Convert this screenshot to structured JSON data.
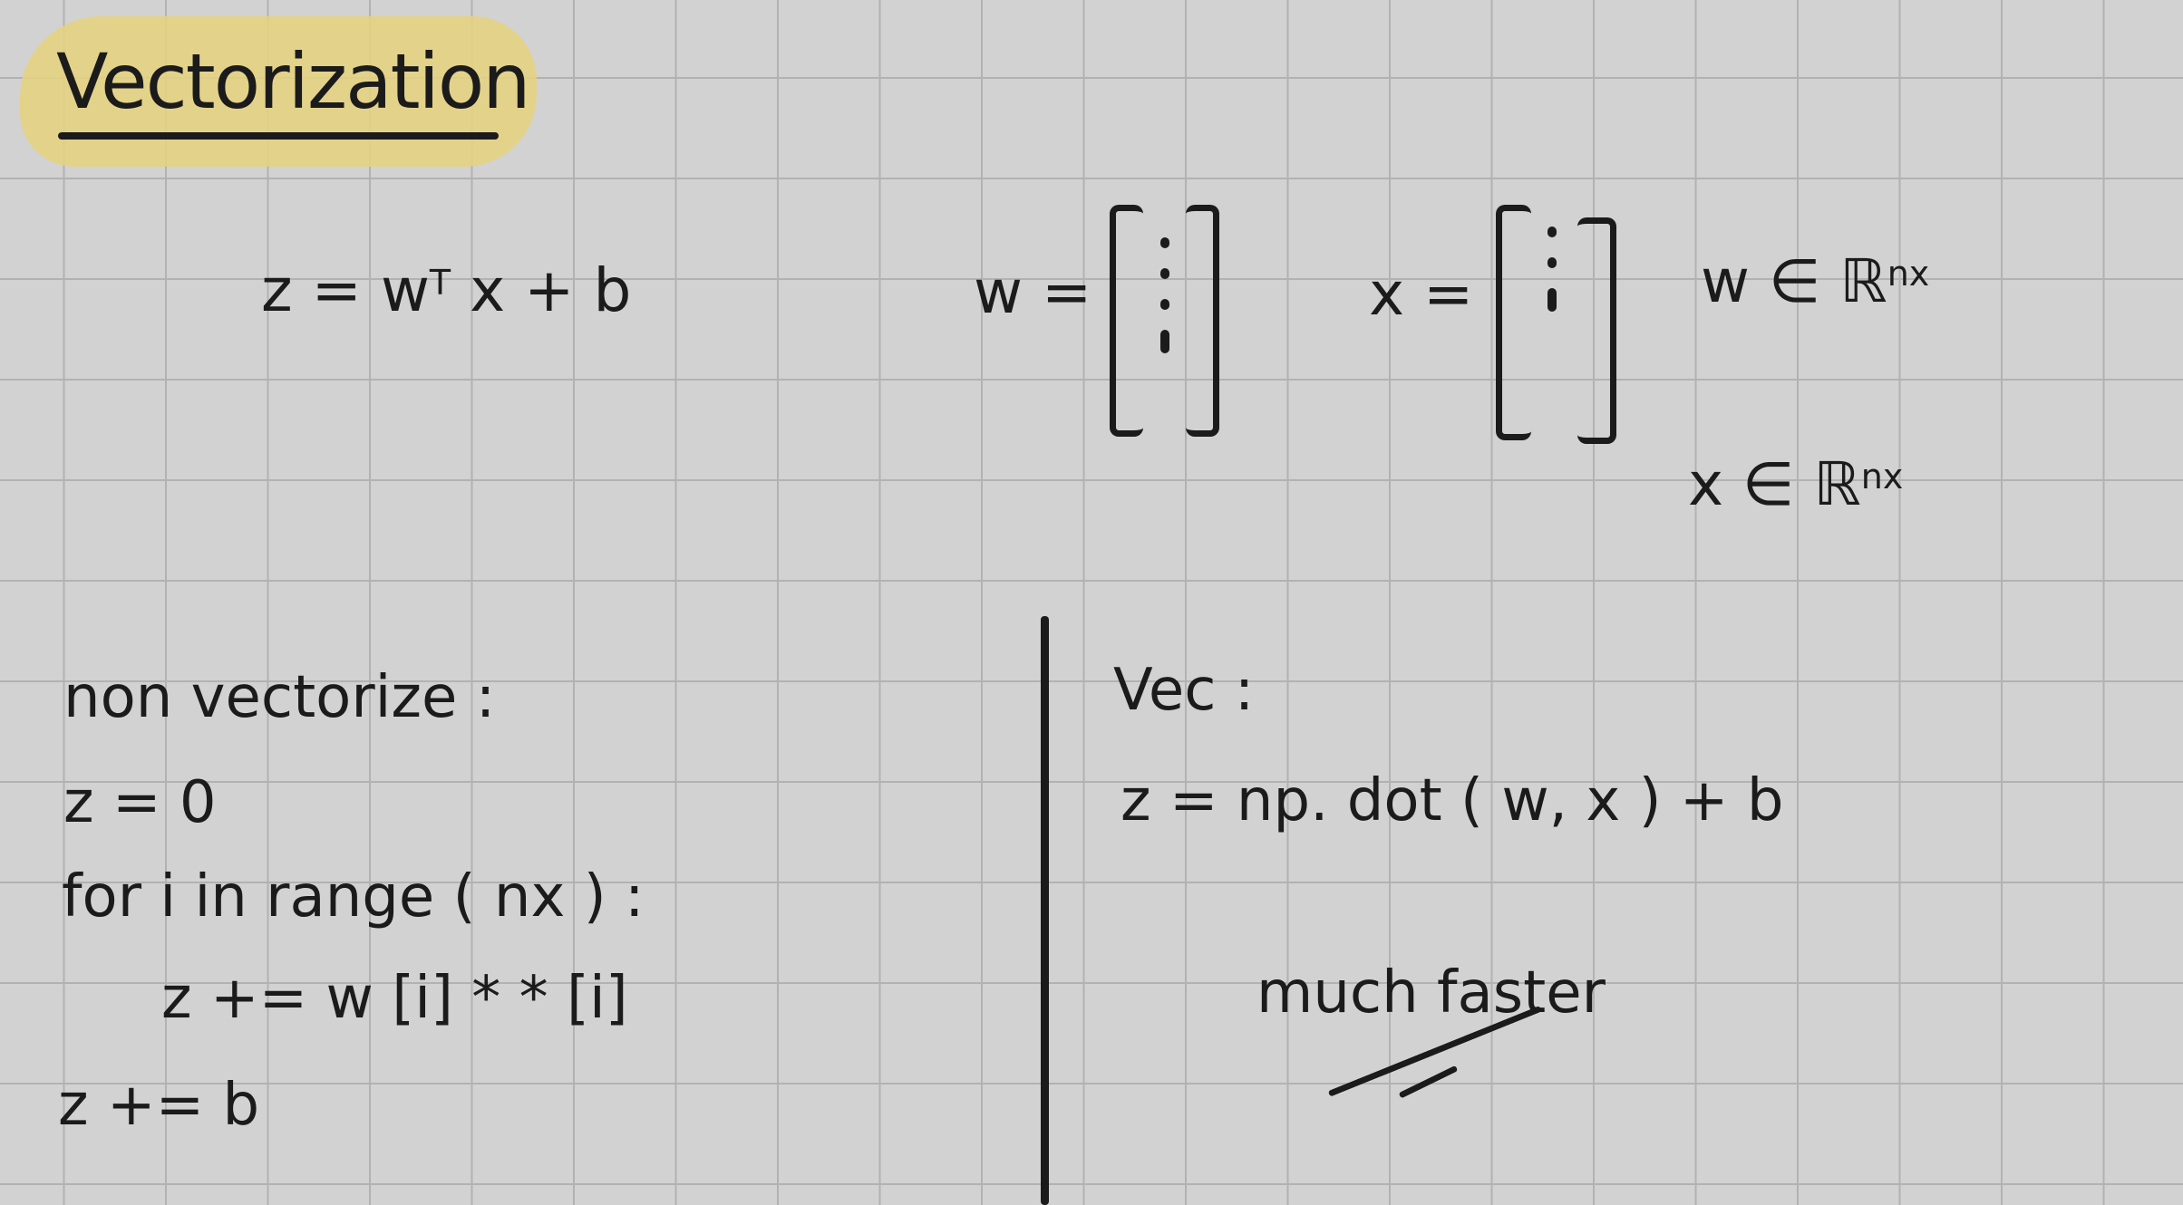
{
  "title": "Vectorization",
  "equation": {
    "lhs": "z",
    "equals": "=",
    "w": "w",
    "transpose": "T",
    "rest": "x + b"
  },
  "vector_w": {
    "label": "w ="
  },
  "vector_x": {
    "label": "x ="
  },
  "domains": {
    "w_in": "w ∈ ℝ",
    "w_exp": "nx",
    "x_in": "x ∈ ℝ",
    "x_exp": "nx"
  },
  "non_vectorized": {
    "heading": "non vectorize :",
    "lines": [
      "z = 0",
      "for i in range ( nx ) :",
      "z += w [i] * * [i]",
      "z += b"
    ]
  },
  "vectorized": {
    "heading": "Vec :",
    "code": "z = np. dot ( w, x ) + b",
    "note": "much faster"
  }
}
